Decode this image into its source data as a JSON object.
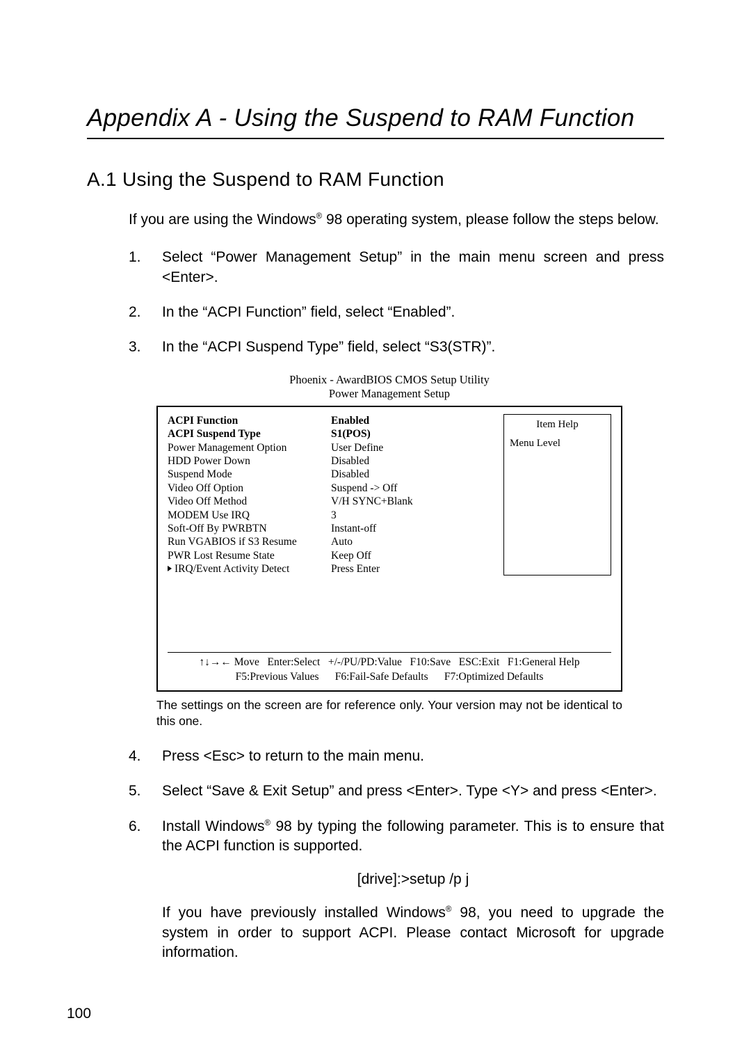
{
  "appendix_title": "Appendix A - Using the Suspend to RAM Function",
  "section_heading": "A.1  Using the Suspend to RAM Function",
  "intro": "If you are using the Windows® 98 operating system, please follow the steps below.",
  "steps": {
    "s1_num": "1.",
    "s1": "Select “Power Management Setup” in the main menu screen and press <Enter>.",
    "s2_num": "2.",
    "s2": "In the “ACPI Function” field, select “Enabled”.",
    "s3_num": "3.",
    "s3": "In the “ACPI Suspend Type” field, select “S3(STR)”.",
    "s4_num": "4.",
    "s4": "Press <Esc> to return to the main menu.",
    "s5_num": "5.",
    "s5": "Select “Save & Exit Setup” and press <Enter>. Type <Y> and press <Enter>.",
    "s6_num": "6.",
    "s6": "Install Windows® 98 by typing the following parameter. This is to ensure that the ACPI function is supported."
  },
  "cmd_line": "[drive]:>setup /p j",
  "post_cmd": "If you have previously installed Windows® 98, you need to upgrade the system in order to support ACPI. Please contact Microsoft for upgrade information.",
  "bios": {
    "caption_line1": "Phoenix - AwardBIOS CMOS Setup Utility",
    "caption_line2": "Power Management Setup",
    "help_title": "Item Help",
    "help_menu": "Menu Level",
    "rows": [
      {
        "lbl": "ACPI Function",
        "val": "Enabled",
        "bold": true
      },
      {
        "lbl": "ACPI Suspend Type",
        "val": "S1(POS)",
        "bold": true
      },
      {
        "lbl": "Power Management Option",
        "val": "User Define",
        "bold": false
      },
      {
        "lbl": "HDD Power Down",
        "val": "Disabled",
        "bold": false
      },
      {
        "lbl": "Suspend Mode",
        "val": "Disabled",
        "bold": false
      },
      {
        "lbl": "Video Off Option",
        "val": "Suspend -> Off",
        "bold": false
      },
      {
        "lbl": "Video Off Method",
        "val": "V/H SYNC+Blank",
        "bold": false
      },
      {
        "lbl": "MODEM Use IRQ",
        "val": "3",
        "bold": false
      },
      {
        "lbl": "Soft-Off By PWRBTN",
        "val": "Instant-off",
        "bold": false
      },
      {
        "lbl": "Run VGABIOS if S3 Resume",
        "val": "Auto",
        "bold": false
      },
      {
        "lbl": "PWR Lost Resume State",
        "val": "Keep Off",
        "bold": false
      },
      {
        "lbl": "IRQ/Event Activity Detect",
        "val": "Press Enter",
        "bold": false,
        "tri": true
      }
    ],
    "footer_line1": "↑↓→← Move   Enter:Select   +/-/PU/PD:Value   F10:Save   ESC:Exit   F1:General Help",
    "footer_line2": "F5:Previous Values      F6:Fail-Safe Defaults      F7:Optimized Defaults"
  },
  "figure_note": "The settings on the screen are for reference only. Your version may not be identical to this one.",
  "page_number": "100"
}
